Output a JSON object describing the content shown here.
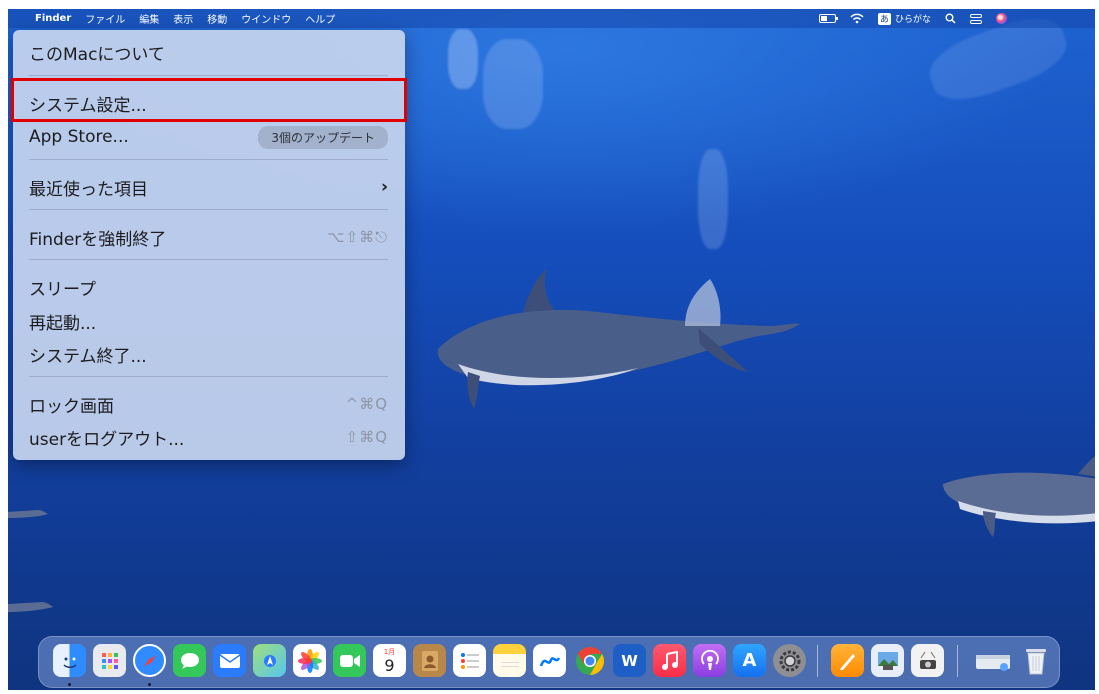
{
  "menubar": {
    "apple": "",
    "app_name": "Finder",
    "menus": [
      "ファイル",
      "編集",
      "表示",
      "移動",
      "ウインドウ",
      "ヘルプ"
    ],
    "ime_char": "あ",
    "ime_label": "ひらがな"
  },
  "apple_menu": {
    "about": "このMacについて",
    "system_settings": "システム設定...",
    "app_store": "App Store...",
    "app_store_badge": "3個のアップデート",
    "recent_items": "最近使った項目",
    "recent_items_chevron": "›",
    "force_quit": "Finderを強制終了",
    "force_quit_shortcut": "⌥⇧⌘⎋",
    "sleep": "スリープ",
    "restart": "再起動...",
    "shutdown": "システム終了...",
    "lock_screen": "ロック画面",
    "lock_screen_shortcut": "^⌘Q",
    "logout": "userをログアウト...",
    "logout_shortcut": "⇧⌘Q"
  },
  "dock": {
    "calendar_month": "1月",
    "calendar_day": "9",
    "word_letter": "W",
    "appstore_letter": "A",
    "apps": [
      "finder",
      "launchpad",
      "safari",
      "messages",
      "mail",
      "maps",
      "photos",
      "facetime",
      "calendar",
      "contacts",
      "reminders",
      "notes",
      "freeform",
      "chrome",
      "word",
      "music",
      "podcasts",
      "app-store",
      "system-settings",
      "pages",
      "preview",
      "screenshot",
      "downloads",
      "trash"
    ]
  },
  "colors": {
    "desktop": "#154ebc",
    "highlight": "#e00000",
    "menu_bg": "#c6d4ee"
  }
}
